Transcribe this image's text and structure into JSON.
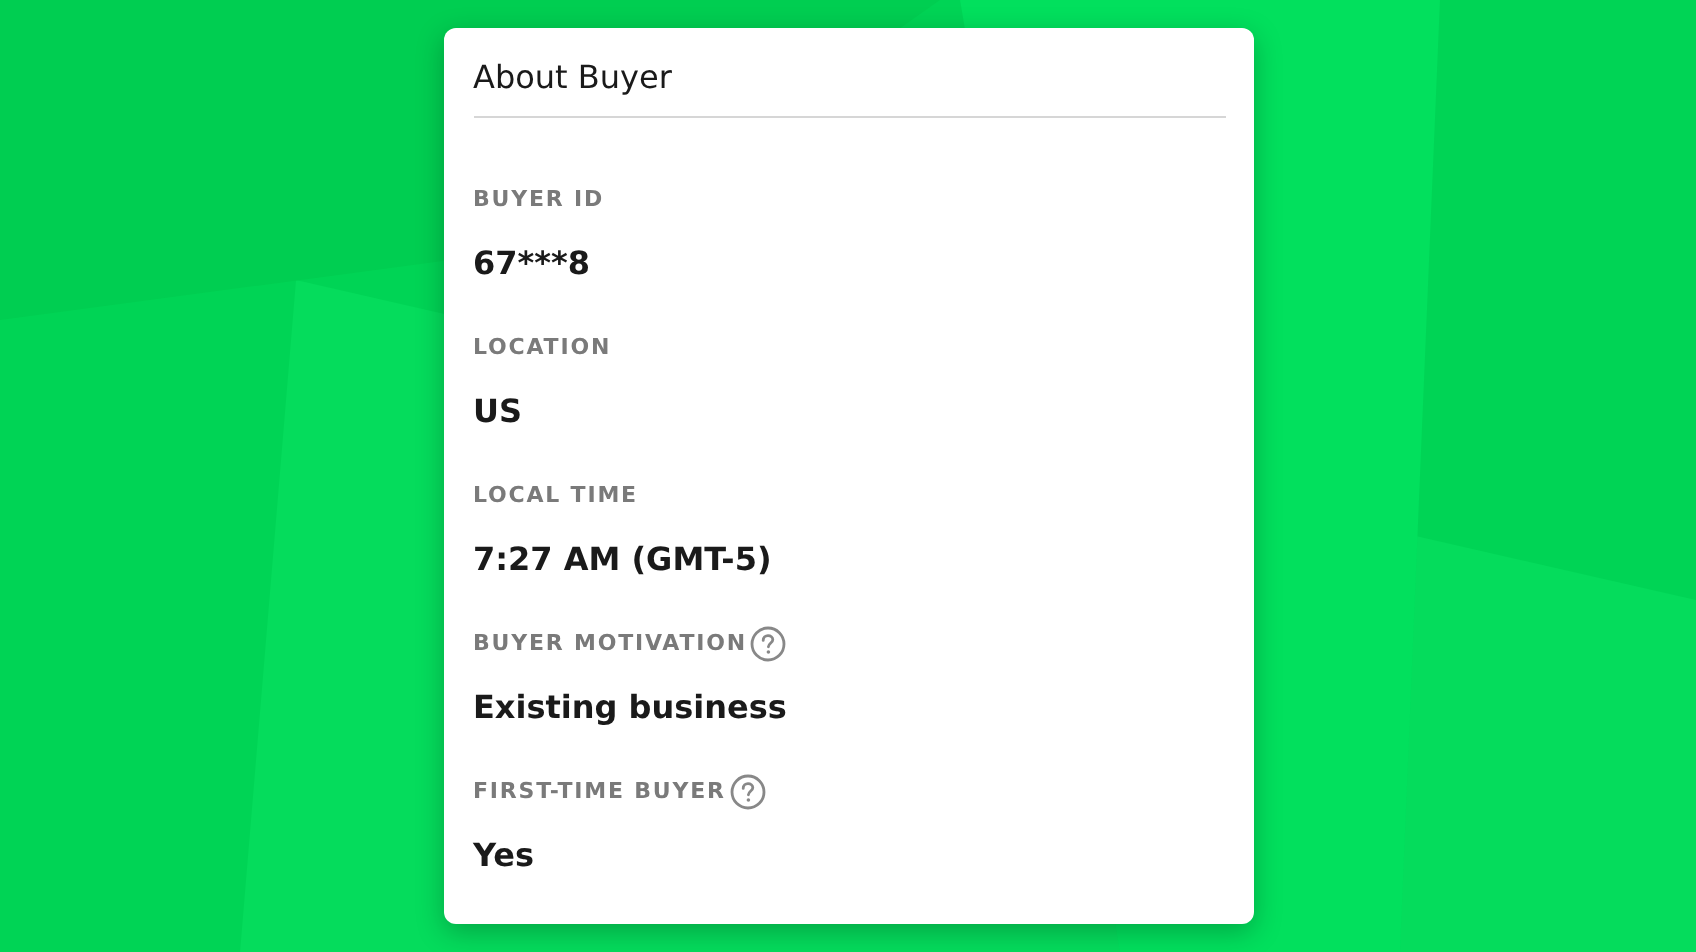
{
  "card": {
    "title": "About Buyer"
  },
  "fields": [
    {
      "label": "BUYER ID",
      "value": "67***8",
      "help": false
    },
    {
      "label": "LOCATION",
      "value": "US",
      "help": false
    },
    {
      "label": "LOCAL TIME",
      "value": "7:27 AM (GMT-5)",
      "help": false
    },
    {
      "label": "BUYER MOTIVATION",
      "value": "Existing business",
      "help": true
    },
    {
      "label": "FIRST-TIME BUYER",
      "value": "Yes",
      "help": true
    }
  ]
}
